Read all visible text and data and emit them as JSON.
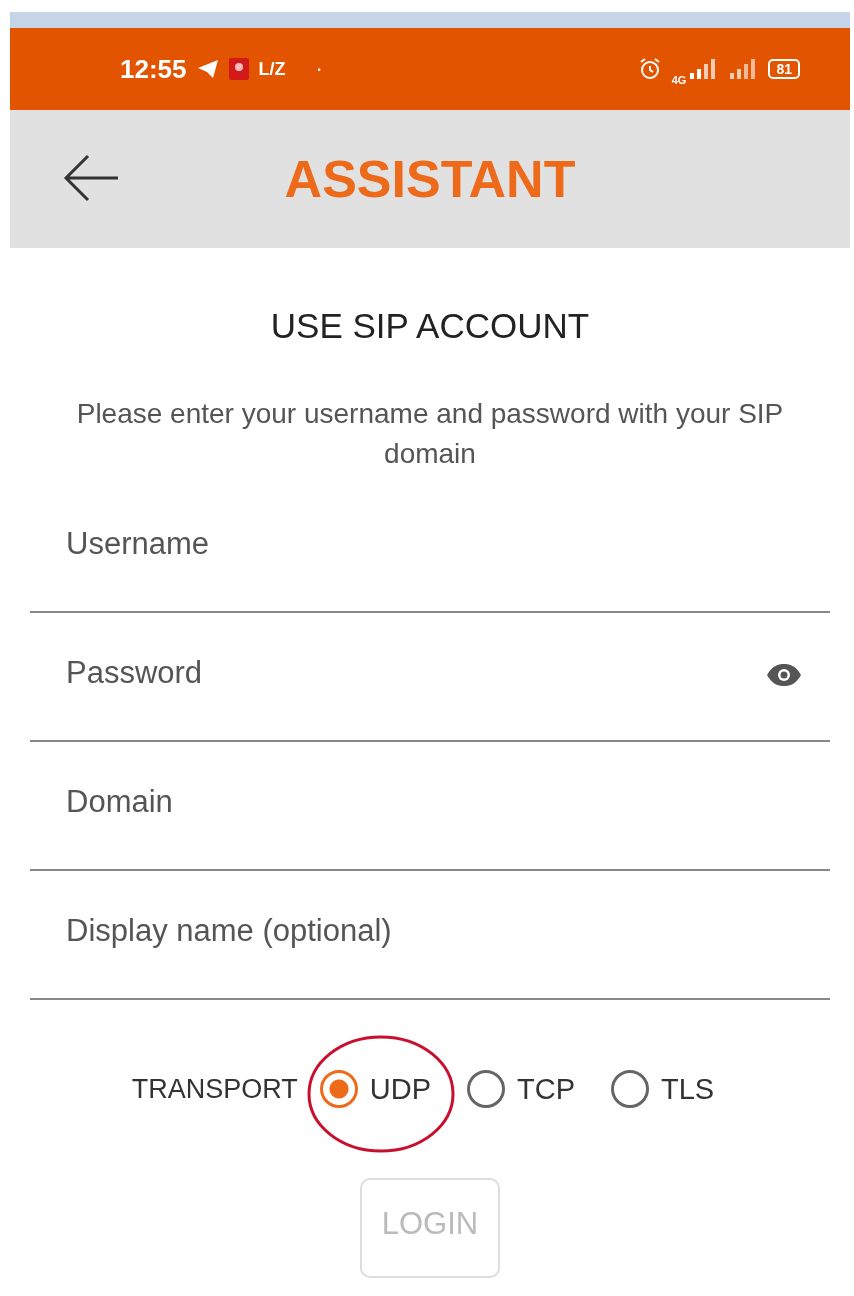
{
  "status_bar": {
    "time": "12:55",
    "carrier_text": "L/Z",
    "dot": "·",
    "network": "4G",
    "battery": "81"
  },
  "app_bar": {
    "title": "ASSISTANT"
  },
  "heading": "USE SIP ACCOUNT",
  "description": "Please enter your username and password with your SIP domain",
  "fields": [
    {
      "placeholder": "Username",
      "kind": "text"
    },
    {
      "placeholder": "Password",
      "kind": "password"
    },
    {
      "placeholder": "Domain",
      "kind": "text"
    },
    {
      "placeholder": "Display name (optional)",
      "kind": "text"
    }
  ],
  "transport": {
    "label": "TRANSPORT",
    "options": [
      {
        "label": "UDP",
        "selected": true,
        "annotated": true
      },
      {
        "label": "TCP",
        "selected": false,
        "annotated": false
      },
      {
        "label": "TLS",
        "selected": false,
        "annotated": false
      }
    ]
  },
  "login_button": {
    "label": "LOGIN",
    "disabled": true
  }
}
